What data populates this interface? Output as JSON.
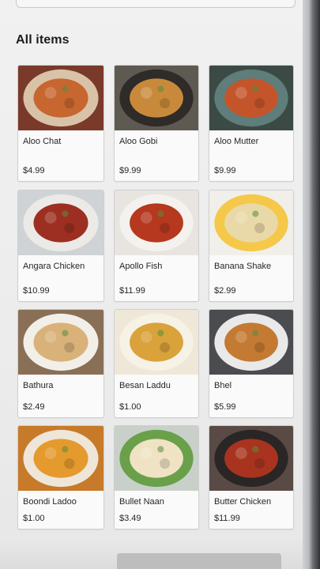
{
  "section": {
    "title": "All items"
  },
  "items": [
    {
      "name": "Aloo Chat",
      "price": "$4.99",
      "icon": "aloo-chat-photo",
      "bg": "#7a3a2a",
      "food": "#c7662f",
      "plate": "#d9c3a8"
    },
    {
      "name": "Aloo Gobi",
      "price": "$9.99",
      "icon": "aloo-gobi-photo",
      "bg": "#5e5a52",
      "food": "#c88a3a",
      "plate": "#2e2b29"
    },
    {
      "name": "Aloo Mutter",
      "price": "$9.99",
      "icon": "aloo-mutter-photo",
      "bg": "#3b4a44",
      "food": "#c4552a",
      "plate": "#5f7d7a"
    },
    {
      "name": "Angara Chicken",
      "price": "$10.99",
      "icon": "angara-chicken-photo",
      "bg": "#cfd3d6",
      "food": "#9d2f22",
      "plate": "#eceae6"
    },
    {
      "name": "Apollo Fish",
      "price": "$11.99",
      "icon": "apollo-fish-photo",
      "bg": "#e8e4df",
      "food": "#b5381f",
      "plate": "#f4f2ee"
    },
    {
      "name": "Banana Shake",
      "price": "$2.99",
      "icon": "banana-shake-photo",
      "bg": "#f1efe9",
      "food": "#ead9a8",
      "plate": "#f5c84a"
    },
    {
      "name": "Bathura",
      "price": "$2.49",
      "icon": "bathura-photo",
      "bg": "#8a6f57",
      "food": "#d9b27a",
      "plate": "#f2efe9"
    },
    {
      "name": "Besan Laddu",
      "price": "$1.00",
      "icon": "besan-laddu-photo",
      "bg": "#efe8d8",
      "food": "#d9a23a",
      "plate": "#f6f2e6"
    },
    {
      "name": "Bhel",
      "price": "$5.99",
      "icon": "bhel-photo",
      "bg": "#4b4c4f",
      "food": "#c47a33",
      "plate": "#e9e9e9"
    },
    {
      "name": "Boondi Ladoo",
      "price": "$1.00",
      "icon": "boondi-ladoo-photo",
      "bg": "#c77a2a",
      "food": "#e59a2e",
      "plate": "#efe6da"
    },
    {
      "name": "Bullet Naan",
      "price": "$3.49",
      "icon": "bullet-naan-photo",
      "bg": "#c9d0c9",
      "food": "#efe3c4",
      "plate": "#6aa04a"
    },
    {
      "name": "Butter Chicken",
      "price": "$11.99",
      "icon": "butter-chicken-photo",
      "bg": "#5a4a45",
      "food": "#a8341f",
      "plate": "#2a2625"
    }
  ]
}
